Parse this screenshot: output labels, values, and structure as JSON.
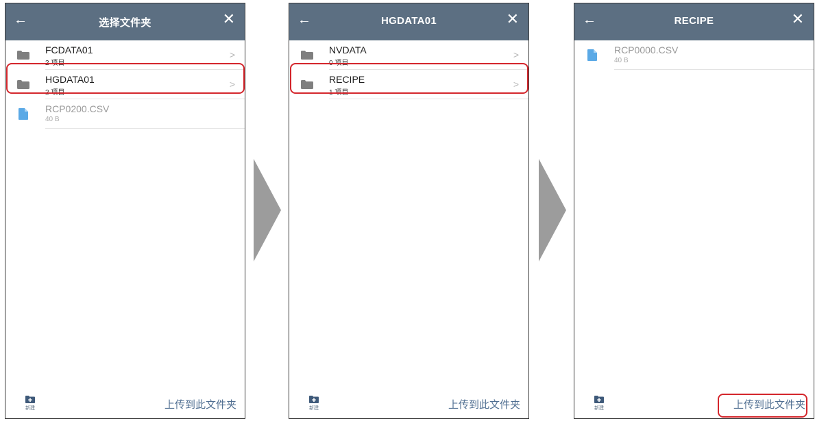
{
  "screens": [
    {
      "title": "选择文件夹",
      "back_icon": "arrow-left-icon",
      "close_icon": "close-icon",
      "items": [
        {
          "type": "folder",
          "name": "FCDATA01",
          "sub": "2 项目"
        },
        {
          "type": "folder",
          "name": "HGDATA01",
          "sub": "2 项目"
        },
        {
          "type": "file",
          "name": "RCP0200.CSV",
          "sub": "40 B"
        }
      ],
      "footer": {
        "new_label": "新建",
        "upload_label": "上传到此文件夹"
      }
    },
    {
      "title": "HGDATA01",
      "items": [
        {
          "type": "folder",
          "name": "NVDATA",
          "sub": "0 项目"
        },
        {
          "type": "folder",
          "name": "RECIPE",
          "sub": "1 项目"
        }
      ],
      "footer": {
        "new_label": "新建",
        "upload_label": "上传到此文件夹"
      }
    },
    {
      "title": "RECIPE",
      "items": [
        {
          "type": "file",
          "name": "RCP0000.CSV",
          "sub": "40 B"
        }
      ],
      "footer": {
        "new_label": "新建",
        "upload_label": "上传到此文件夹"
      }
    }
  ],
  "glyphs": {
    "back": "←",
    "close": "✕",
    "chevron": ">"
  },
  "colors": {
    "header": "#5c6f82",
    "highlight": "#d4262c",
    "folder_icon": "#7f7f7f",
    "file_icon": "#5aa9e6",
    "upload_text": "#4f6e91",
    "arrow": "#9c9c9c"
  }
}
